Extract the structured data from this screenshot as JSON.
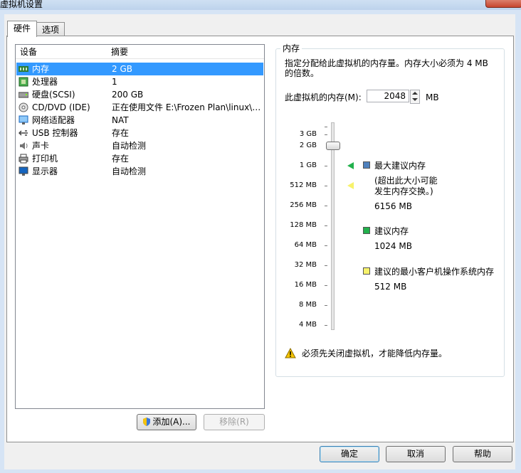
{
  "window": {
    "title": "虚拟机设置"
  },
  "tabs": [
    {
      "label": "硬件"
    },
    {
      "label": "选项"
    }
  ],
  "device_list": {
    "headers": {
      "device": "设备",
      "summary": "摘要"
    },
    "rows": [
      {
        "name": "内存",
        "summary": "2 GB"
      },
      {
        "name": "处理器",
        "summary": "1"
      },
      {
        "name": "硬盘(SCSI)",
        "summary": "200 GB"
      },
      {
        "name": "CD/DVD (IDE)",
        "summary": "正在使用文件 E:\\Frozen Plan\\linux\\0..."
      },
      {
        "name": "网络适配器",
        "summary": "NAT"
      },
      {
        "name": "USB 控制器",
        "summary": "存在"
      },
      {
        "name": "声卡",
        "summary": "自动检测"
      },
      {
        "name": "打印机",
        "summary": "存在"
      },
      {
        "name": "显示器",
        "summary": "自动检测"
      }
    ]
  },
  "buttons": {
    "add": "添加(A)...",
    "remove": "移除(R)",
    "ok": "确定",
    "cancel": "取消",
    "help": "帮助"
  },
  "memory": {
    "group_title": "内存",
    "description": "指定分配给此虚拟机的内存量。内存大小必须为 4 MB 的倍数。",
    "field_label": "此虚拟机的内存(M):",
    "value": "2048",
    "unit": "MB",
    "scale_labels": [
      "3 GB",
      "2 GB",
      "1 GB",
      "512 MB",
      "256 MB",
      "128 MB",
      "64 MB",
      "32 MB",
      "16 MB",
      "8 MB",
      "4 MB"
    ],
    "legend": {
      "max_title": "最大建议内存",
      "max_note_line1": "(超出此大小可能",
      "max_note_line2": "发生内存交换。)",
      "max_value": "6156 MB",
      "rec_title": "建议内存",
      "rec_value": "1024 MB",
      "min_title": "建议的最小客户机操作系统内存",
      "min_value": "512 MB"
    },
    "warning": "必须先关闭虚拟机，才能降低内存量。",
    "colors": {
      "max": "#4f81bd",
      "recommended": "#22b14c",
      "minimum": "#f7f26b"
    }
  }
}
